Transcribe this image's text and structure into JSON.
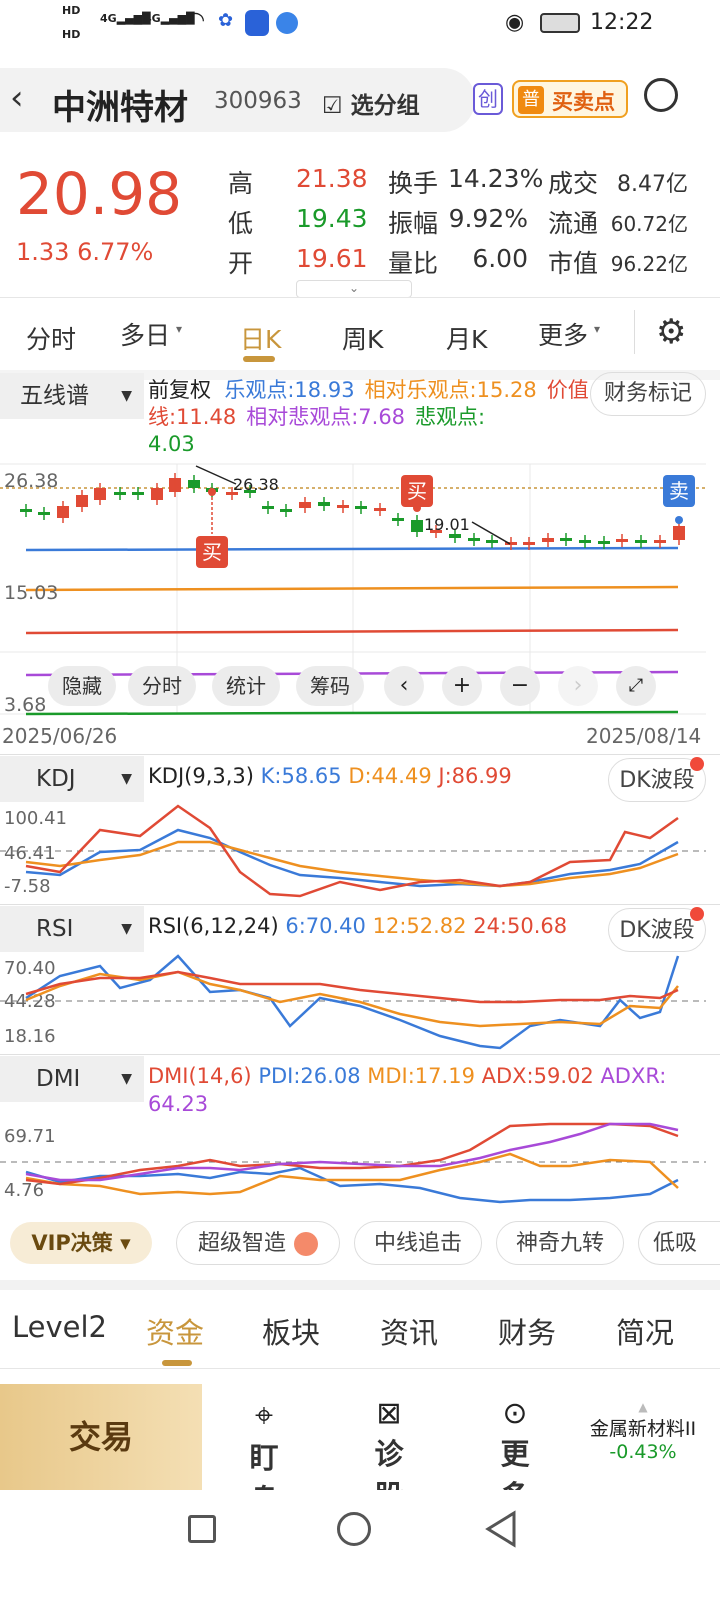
{
  "status_bar": {
    "hd1": "HD",
    "hd2": "HD",
    "net1": "4G",
    "net2": "4G",
    "time": "12:22"
  },
  "header": {
    "name": "中洲特材",
    "code": "300963",
    "group_label": "选分组",
    "chuang": "创",
    "pu": "普",
    "buysell_label": "买卖点"
  },
  "quote": {
    "price": "20.98",
    "change": "1.33",
    "pct": "6.77%",
    "rows": [
      {
        "k1": "高",
        "v1": "21.38",
        "k2": "换手",
        "v2": "14.23%",
        "k3": "成交",
        "v3": "8.47亿"
      },
      {
        "k1": "低",
        "v1": "19.43",
        "k2": "振幅",
        "v2": "9.92%",
        "k3": "流通",
        "v3": "60.72亿"
      },
      {
        "k1": "开",
        "v1": "19.61",
        "k2": "量比",
        "v2": "6.00",
        "k3": "市值",
        "v3": "96.22亿"
      }
    ]
  },
  "tabs": [
    "分时",
    "多日",
    "日K",
    "周K",
    "月K",
    "更多"
  ],
  "main": {
    "indicator": "五线谱",
    "fuquan": "前复权",
    "legend": [
      {
        "t": "乐观点:18.93",
        "c": "#3a7ad8"
      },
      {
        "t": "相对乐观点:15.28",
        "c": "#ee9020"
      },
      {
        "t": "价值线:11.48",
        "c": "#e04a35"
      },
      {
        "t": "相对悲观点:7.68",
        "c": "#a84ad8"
      },
      {
        "t": "悲观点:",
        "c": "#1a9a2a"
      },
      {
        "t": "4.03",
        "c": "#1a9a2a"
      }
    ],
    "finance_mark": "财务标记",
    "y_max": "26.38",
    "y_mid": "15.03",
    "y_min": "3.68",
    "high_label": "26.38",
    "low_label": "19.01",
    "buy": "买",
    "sell": "卖",
    "date_start": "2025/06/26",
    "date_end": "2025/08/14",
    "controls": [
      "隐藏",
      "分时",
      "统计",
      "筹码"
    ]
  },
  "kdj": {
    "name": "KDJ",
    "params": "KDJ(9,3,3)",
    "k": "K:58.65",
    "d": "D:44.49",
    "j": "J:86.99",
    "btn": "DK波段",
    "y1": "100.41",
    "y2": "46.41",
    "y3": "-7.58"
  },
  "rsi": {
    "name": "RSI",
    "params": "RSI(6,12,24)",
    "r6": "6:70.40",
    "r12": "12:52.82",
    "r24": "24:50.68",
    "btn": "DK波段",
    "y1": "70.40",
    "y2": "44.28",
    "y3": "18.16"
  },
  "dmi": {
    "name": "DMI",
    "params": "DMI(14,6)",
    "pdi": "PDI:26.08",
    "mdi": "MDI:17.19",
    "adx": "ADX:59.02",
    "adxr1": "ADXR:",
    "adxr2": "64.23",
    "y1": "69.71",
    "y2": "4.76"
  },
  "strategy": {
    "vip": "VIP决策",
    "pills": [
      "超级智造",
      "中线追击",
      "神奇九转",
      "低吸"
    ]
  },
  "bottom_tabs": [
    "Level2",
    "资金",
    "板块",
    "资讯",
    "财务",
    "简况"
  ],
  "nav": {
    "trade": "交易",
    "items": [
      "盯盘",
      "诊股",
      "更多"
    ],
    "sector": "金属新材料II",
    "sector_chg": "-0.43%"
  },
  "colors": {
    "up": "#e04a35",
    "down": "#1a9a2a",
    "accent": "#c8963c"
  }
}
